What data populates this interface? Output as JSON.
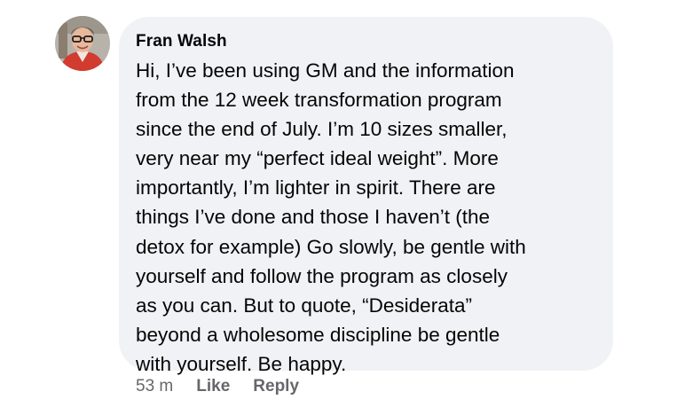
{
  "comment": {
    "author": "Fran Walsh",
    "text": "Hi, I’ve been using GM and the information\nfrom the 12 week transformation program\nsince the end of July. I’m 10 sizes smaller,\nvery near my “perfect ideal weight”.  More\nimportantly, I’m lighter in spirit.  There are\nthings I’ve done and those I haven’t (the\ndetox for example) Go slowly, be gentle with\nyourself and follow the program as closely\nas you can. But to quote, “Desiderata”\nbeyond a wholesome discipline be gentle\nwith yourself. Be happy.",
    "timestamp": "53 m",
    "like_label": "Like",
    "reply_label": "Reply"
  },
  "colors": {
    "bubble_background": "#f0f2f5",
    "text": "#050505",
    "secondary_text": "#65676b"
  },
  "icons": {
    "avatar": "profile-photo"
  }
}
